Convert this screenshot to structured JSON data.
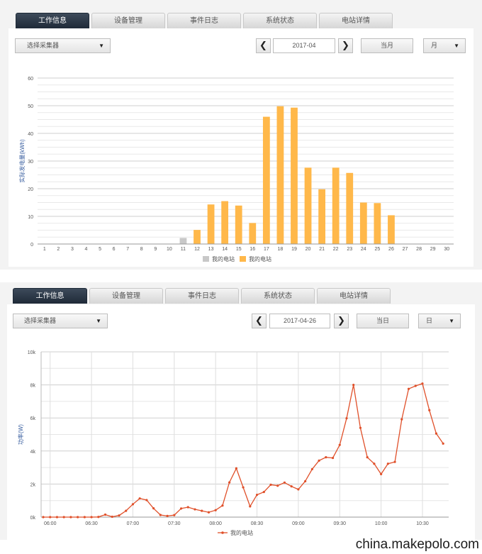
{
  "top_panel": {
    "tabs": [
      {
        "label": "工作信息",
        "active": true
      },
      {
        "label": "设备管理",
        "active": false
      },
      {
        "label": "事件日志",
        "active": false
      },
      {
        "label": "系统状态",
        "active": false
      },
      {
        "label": "电站详情",
        "active": false
      }
    ],
    "collector_select": "选择采集器",
    "date_value": "2017-04",
    "period_button": "当月",
    "granularity_select": "月"
  },
  "bottom_panel": {
    "tabs": [
      {
        "label": "工作信息",
        "active": true
      },
      {
        "label": "设备管理",
        "active": false
      },
      {
        "label": "事件日志",
        "active": false
      },
      {
        "label": "系统状态",
        "active": false
      },
      {
        "label": "电站详情",
        "active": false
      }
    ],
    "collector_select": "选择采集器",
    "date_value": "2017-04-26",
    "period_button": "当日",
    "granularity_select": "日"
  },
  "icons": {
    "prev": "chevron-left-icon",
    "next": "chevron-right-icon",
    "dropdown": "caret-down-icon"
  },
  "chart_data": [
    {
      "type": "bar",
      "ylabel": "实际发电量(kWh)",
      "ylim": [
        0,
        60
      ],
      "yticks": [
        0,
        10,
        20,
        30,
        40,
        50,
        60
      ],
      "categories": [
        "1",
        "2",
        "3",
        "4",
        "5",
        "6",
        "7",
        "8",
        "9",
        "10",
        "11",
        "12",
        "13",
        "14",
        "15",
        "16",
        "17",
        "18",
        "19",
        "20",
        "21",
        "22",
        "23",
        "24",
        "25",
        "26",
        "27",
        "28",
        "29",
        "30"
      ],
      "series": [
        {
          "name": "我的电站",
          "color": "#c8c8c8",
          "values": [
            0,
            0,
            0,
            0,
            0,
            0,
            0,
            0,
            0,
            0,
            2.2,
            0,
            0,
            0,
            0,
            0,
            0,
            0,
            0,
            0,
            0,
            0,
            0,
            0,
            0,
            0,
            0,
            0,
            0,
            0
          ]
        },
        {
          "name": "我的电站",
          "color": "#ffb84a",
          "values": [
            0,
            0,
            0,
            0,
            0,
            0,
            0,
            0,
            0,
            0,
            0,
            5.1,
            14.3,
            15.5,
            13.9,
            7.6,
            46,
            49.8,
            49.3,
            27.6,
            19.8,
            27.6,
            25.7,
            15,
            14.8,
            10.4,
            0,
            0,
            0,
            0
          ]
        }
      ],
      "legend_position": "bottom-center",
      "grid": true
    },
    {
      "type": "line",
      "ylabel": "功率(W)",
      "ylim": [
        0,
        10000
      ],
      "yticks": [
        "0k",
        "2k",
        "4k",
        "6k",
        "8k",
        "10k"
      ],
      "xtick_labels": [
        "06:00",
        "06:30",
        "07:00",
        "07:30",
        "08:00",
        "08:30",
        "09:00",
        "09:30",
        "10:00",
        "10:30"
      ],
      "x_start": "05:55",
      "x_step_minutes": 5,
      "series": [
        {
          "name": "我的电站",
          "color": "#e0502a",
          "values": [
            0,
            0,
            0,
            0,
            0,
            0,
            0,
            0,
            10,
            150,
            20,
            100,
            380,
            780,
            1130,
            1030,
            530,
            130,
            70,
            120,
            520,
            600,
            470,
            380,
            290,
            420,
            700,
            2100,
            2950,
            1800,
            650,
            1350,
            1520,
            1960,
            1900,
            2090,
            1860,
            1680,
            2170,
            2900,
            3420,
            3620,
            3580,
            4370,
            5980,
            8000,
            5400,
            3620,
            3230,
            2600,
            3230,
            3340,
            5920,
            7760,
            7940,
            8080,
            6470,
            5060,
            4450
          ]
        }
      ],
      "legend_position": "bottom-center",
      "grid": true
    }
  ],
  "watermark": "china.makepolo.com"
}
